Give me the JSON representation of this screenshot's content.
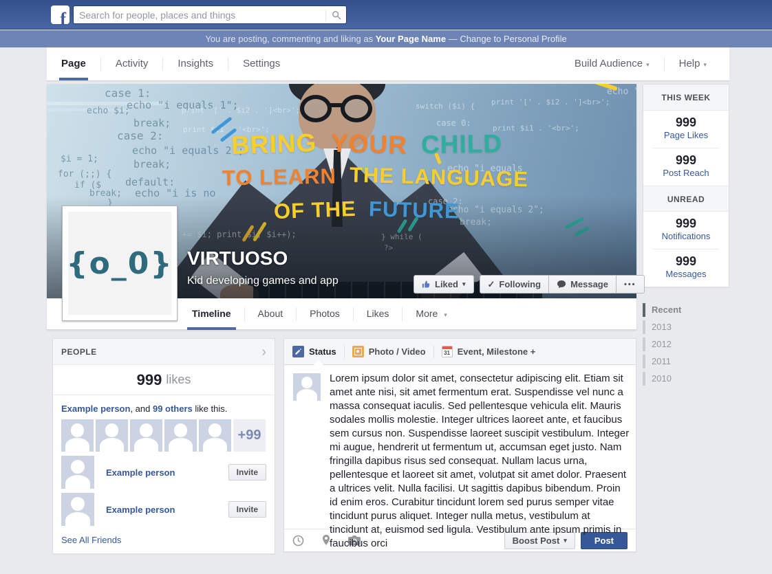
{
  "colors": {
    "nav_blue": "#3b5998",
    "voice_bar_blue": "#6d84b4",
    "link_blue": "#365899",
    "tab_underline_blue": "#4e69a2",
    "post_button_blue": "#365899",
    "cover_yellow": "#f7ce2d",
    "cover_orange": "#ee8230",
    "cover_teal": "#2fae9e",
    "cover_blue": "#4197d5",
    "monogram_teal": "#2e6b7d",
    "page_background": "#e9eaed"
  },
  "topnav": {
    "logo": "f",
    "search_placeholder": "Search for people, places and things"
  },
  "voice_bar": {
    "prefix": "You are posting, commenting and liking as ",
    "page_name": "Your Page Name",
    "separator": " — ",
    "change_link": "Change to Personal Profile"
  },
  "admin_nav": {
    "tabs": [
      "Page",
      "Activity",
      "Insights",
      "Settings"
    ],
    "build_audience": "Build Audience",
    "help": "Help"
  },
  "cover": {
    "title_line1": [
      "BRING",
      "YOUR",
      "CHILD"
    ],
    "title_line2": [
      "TO LEARN",
      "THE LANGUAGE"
    ],
    "title_line3": [
      "OF THE",
      "FUTURE"
    ],
    "code": [
      "case 1:",
      "echo \"i equals 1\";",
      "echo $i;",
      "break;",
      "print '[' . $i2 . ']<br>';",
      "case 2:",
      "print $i1 . '<br>';",
      "echo \"i equals 2\";",
      "$i = 1;",
      "break;",
      "for (;;) {",
      "if ($",
      "default:",
      "break;",
      "echo \"i is no",
      "}",
      "echo $i;",
      "echo \"i e",
      "print '[' . $i2 . ']<br>';",
      "switch ($i) {",
      "case 0:",
      "print $i1 . '<br>';",
      "echo \"i equals",
      "case 2:",
      "echo \"i equals 2\";",
      "break;",
      "10; $i += $i; print $i; $i++);",
      "} while (",
      "?>"
    ],
    "monogram": "{o_0}",
    "page_name": "VIRTUOSO",
    "tagline": "Kid developing games and app",
    "liked_button": "Liked",
    "following_button": "Following",
    "message_button": "Message",
    "more_button": "•••"
  },
  "page_tabs": {
    "timeline": "Timeline",
    "about": "About",
    "photos": "Photos",
    "likes": "Likes",
    "more": "More"
  },
  "right_rail": {
    "this_week_header": "THIS WEEK",
    "page_likes_value": "999",
    "page_likes_label": "Page Likes",
    "post_reach_value": "999",
    "post_reach_label": "Post Reach",
    "unread_header": "UNREAD",
    "notifications_value": "999",
    "notifications_label": "Notifications",
    "messages_value": "999",
    "messages_label": "Messages",
    "timeline_nav": [
      "Recent",
      "2013",
      "2012",
      "2011",
      "2010"
    ]
  },
  "people": {
    "header": "PEOPLE",
    "likes_value": "999",
    "likes_label": "likes",
    "liked_by_name": "Example person",
    "liked_by_mid": ", and ",
    "liked_by_others": "99 others",
    "liked_by_suffix": " like this.",
    "more_avatars": "+99",
    "invite_rows": [
      {
        "name": "Example person",
        "button": "Invite"
      },
      {
        "name": "Example person",
        "button": "Invite"
      }
    ],
    "see_all": "See All Friends"
  },
  "composer": {
    "status_tab": "Status",
    "photo_tab": "Photo / Video",
    "event_tab": "Event, Milestone +",
    "calendar_day": "31",
    "status_text": "Lorem ipsum dolor sit amet, consectetur adipiscing elit. Etiam sit amet ante nisi, sit amet fermentum erat. Suspendisse vel nunc a massa consequat iaculis. Sed pellentesque vehicula elit. Mauris sodales mollis molestie. Integer ultrices laoreet ante, et faucibus sem cursus non. Suspendisse laoreet suscipit vestibulum. Integer mi augue, hendrerit ut fermentum ut, accumsan eget justo. Nam fringilla dapibus risus sed consequat. Nullam lacus urna, pellentesque et laoreet sit amet, volutpat sit amet dolor. Praesent a ultrices velit. Nulla facilisi. Ut sagittis dapibus bibendum. Proin id enim eros. Curabitur tincidunt lorem sed purus semper vitae tincidunt purus aliquet. Integer nulla metus, vestibulum at tincidunt at, euismod sed ligula. Vestibulum ante ipsum primis in faucibus orci",
    "boost_button": "Boost Post",
    "post_button": "Post"
  }
}
